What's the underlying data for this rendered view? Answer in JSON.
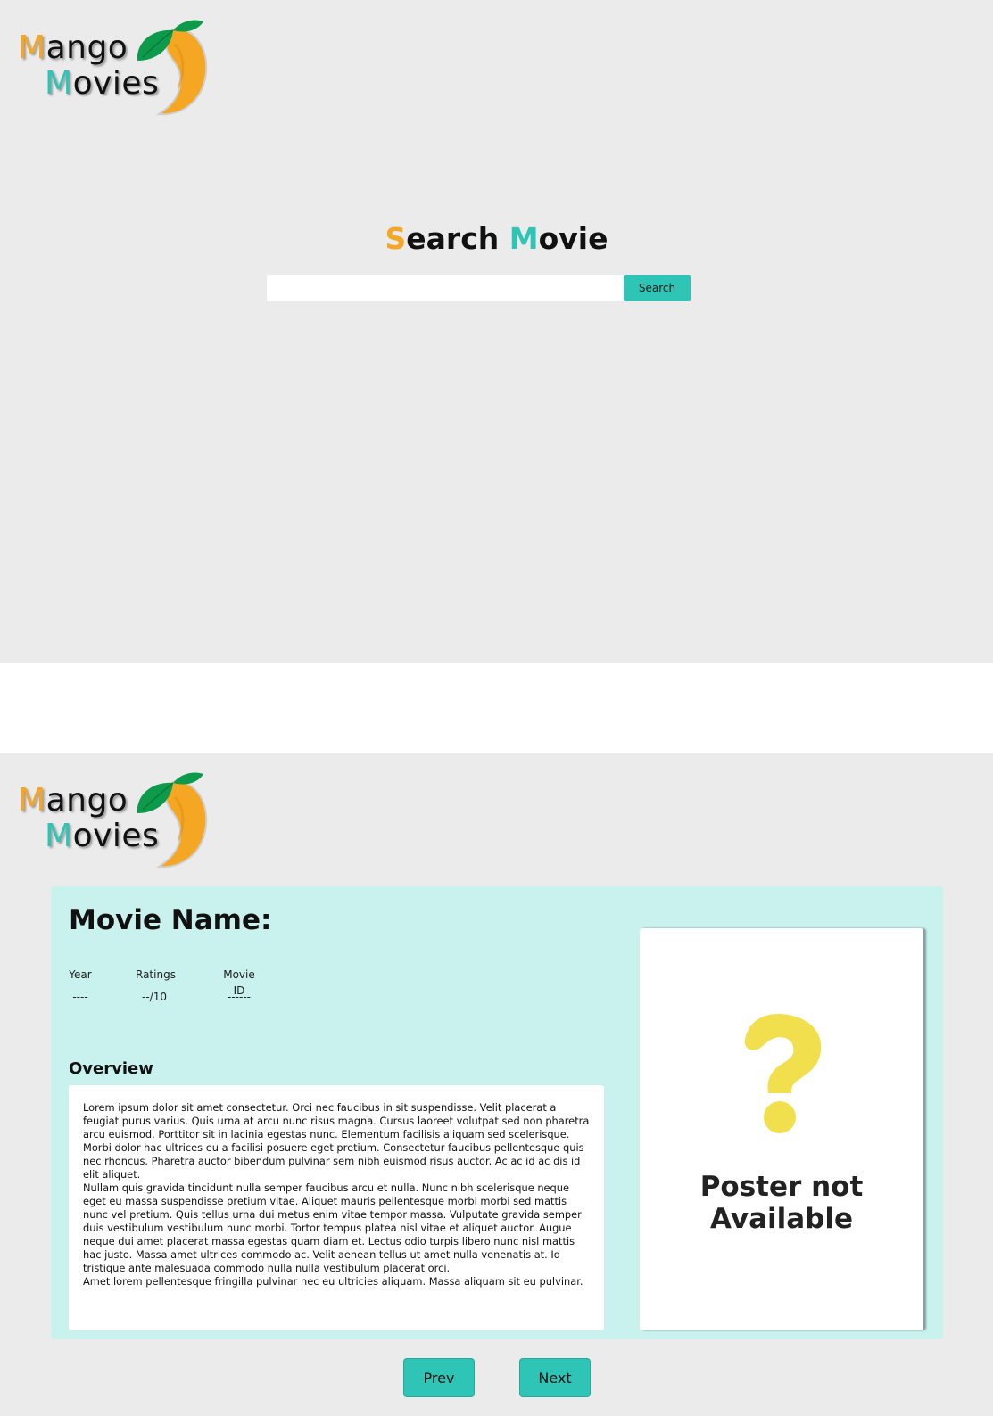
{
  "logo": {
    "line1_initial": "M",
    "line1_rest": "ango",
    "line2_initial": "M",
    "line2_rest": "ovies",
    "icon": "mango-icon"
  },
  "search": {
    "title_initial_1": "S",
    "title_rest_1": "earch ",
    "title_initial_2": "M",
    "title_rest_2": "ovie",
    "input_value": "",
    "input_placeholder": "",
    "button_label": "Search"
  },
  "details": {
    "movie_name_label": "Movie Name:",
    "year_label": "Year",
    "year_value": "----",
    "ratings_label": "Ratings",
    "ratings_value": "--/10",
    "id_label": "Movie ID",
    "id_value": "------",
    "overview_title": "Overview",
    "overview_paragraphs": [
      "Lorem ipsum dolor sit amet consectetur. Orci nec faucibus in sit suspendisse. Velit placerat a feugiat purus varius. Quis urna at arcu nunc risus magna. Cursus laoreet volutpat sed non pharetra arcu euismod. Porttitor sit in lacinia egestas nunc. Elementum facilisis aliquam sed scelerisque. Morbi dolor hac ultrices eu a facilisi posuere eget pretium. Consectetur faucibus pellentesque quis nec rhoncus. Pharetra auctor bibendum pulvinar sem nibh euismod risus auctor. Ac ac id ac dis id elit aliquet.",
      "Nullam quis gravida tincidunt nulla semper faucibus arcu et nulla. Nunc nibh scelerisque neque eget eu massa suspendisse pretium vitae. Aliquet mauris pellentesque morbi morbi sed mattis nunc vel pretium. Quis tellus urna dui metus enim vitae tempor massa. Vulputate gravida semper duis vestibulum vestibulum nunc morbi. Tortor tempus platea nisl vitae et aliquet auctor. Augue neque dui amet placerat massa egestas quam diam et. Lectus odio turpis libero nunc nisl mattis hac justo. Massa amet ultrices commodo ac. Velit aenean tellus ut amet nulla venenatis at. Id tristique ante malesuada commodo nulla nulla vestibulum placerat orci.",
      "Amet lorem pellentesque fringilla pulvinar nec eu ultricies aliquam. Massa aliquam sit eu pulvinar."
    ],
    "poster_icon": "question-mark-icon",
    "poster_text_line1": "Poster not",
    "poster_text_line2": "Available"
  },
  "nav": {
    "prev_label": "Prev",
    "next_label": "Next"
  },
  "colors": {
    "background": "#ebebeb",
    "accent_orange": "#f5a623",
    "accent_teal": "#2ec4b6",
    "card_background": "#c9f1ed",
    "question_mark": "#f2df4e",
    "leaf_green": "#0d9a4b"
  }
}
